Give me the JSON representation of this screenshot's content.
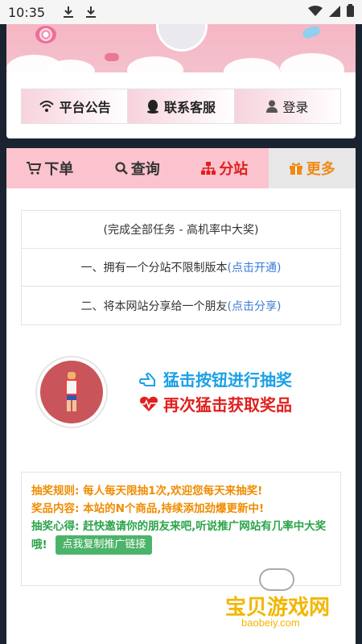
{
  "status_bar": {
    "time": "10:35"
  },
  "top_buttons": {
    "announcement": "平台公告",
    "support": "联系客服",
    "login": "登录"
  },
  "tabs": [
    {
      "label": "下单"
    },
    {
      "label": "查询"
    },
    {
      "label": "分站"
    },
    {
      "label": "更多"
    }
  ],
  "tasks": {
    "header": "(完成全部任务 - 高机率中大奖)",
    "task1_text": "一、拥有一个分站不限制版本 ",
    "task1_link": "(点击开通)",
    "task2_text": "二、将本网站分享给一个朋友 ",
    "task2_link": "(点击分享)"
  },
  "lottery": {
    "line1": "猛击按钮进行抽奖",
    "line2": "再次猛击获取奖品"
  },
  "rules": {
    "rule_label": "抽奖规则:",
    "rule_text": "每人每天限抽1次,欢迎您每天来抽奖!",
    "prize_label": "奖品内容:",
    "prize_text": "本站的N个商品,持续添加劲爆更新中!",
    "tip_label": "抽奖心得:",
    "tip_text": "赶快邀请你的朋友来吧,听说推广网站有几率中大奖哦!",
    "copy_button": "点我复制推广链接"
  },
  "watermark": {
    "name": "宝贝游戏网",
    "url": "baobeiy.com"
  },
  "colors": {
    "tab_bg": "#fbc3ce",
    "tab_more_bg": "#e7e7e7",
    "accent_red": "#e02020",
    "accent_orange": "#ef8a16",
    "accent_blue": "#1aa0e6",
    "link_blue": "#3a7bd5",
    "green": "#2aa44a"
  }
}
